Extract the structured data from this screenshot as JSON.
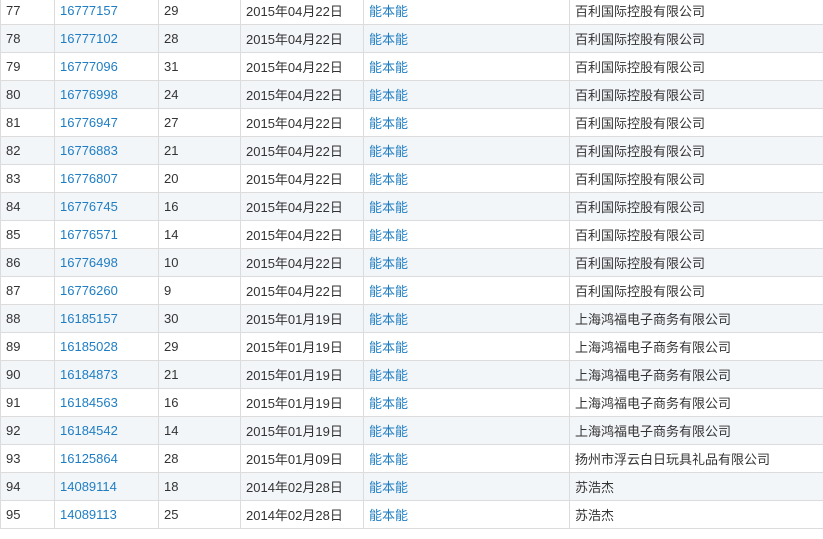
{
  "records": [
    {
      "index": "77",
      "reg_no": "16777157",
      "class": "29",
      "date": "2015年04月22日",
      "name": "能本能",
      "applicant": "百利国际控股有限公司"
    },
    {
      "index": "78",
      "reg_no": "16777102",
      "class": "28",
      "date": "2015年04月22日",
      "name": "能本能",
      "applicant": "百利国际控股有限公司"
    },
    {
      "index": "79",
      "reg_no": "16777096",
      "class": "31",
      "date": "2015年04月22日",
      "name": "能本能",
      "applicant": "百利国际控股有限公司"
    },
    {
      "index": "80",
      "reg_no": "16776998",
      "class": "24",
      "date": "2015年04月22日",
      "name": "能本能",
      "applicant": "百利国际控股有限公司"
    },
    {
      "index": "81",
      "reg_no": "16776947",
      "class": "27",
      "date": "2015年04月22日",
      "name": "能本能",
      "applicant": "百利国际控股有限公司"
    },
    {
      "index": "82",
      "reg_no": "16776883",
      "class": "21",
      "date": "2015年04月22日",
      "name": "能本能",
      "applicant": "百利国际控股有限公司"
    },
    {
      "index": "83",
      "reg_no": "16776807",
      "class": "20",
      "date": "2015年04月22日",
      "name": "能本能",
      "applicant": "百利国际控股有限公司"
    },
    {
      "index": "84",
      "reg_no": "16776745",
      "class": "16",
      "date": "2015年04月22日",
      "name": "能本能",
      "applicant": "百利国际控股有限公司"
    },
    {
      "index": "85",
      "reg_no": "16776571",
      "class": "14",
      "date": "2015年04月22日",
      "name": "能本能",
      "applicant": "百利国际控股有限公司"
    },
    {
      "index": "86",
      "reg_no": "16776498",
      "class": "10",
      "date": "2015年04月22日",
      "name": "能本能",
      "applicant": "百利国际控股有限公司"
    },
    {
      "index": "87",
      "reg_no": "16776260",
      "class": "9",
      "date": "2015年04月22日",
      "name": "能本能",
      "applicant": "百利国际控股有限公司"
    },
    {
      "index": "88",
      "reg_no": "16185157",
      "class": "30",
      "date": "2015年01月19日",
      "name": "能本能",
      "applicant": "上海鸿福电子商务有限公司"
    },
    {
      "index": "89",
      "reg_no": "16185028",
      "class": "29",
      "date": "2015年01月19日",
      "name": "能本能",
      "applicant": "上海鸿福电子商务有限公司"
    },
    {
      "index": "90",
      "reg_no": "16184873",
      "class": "21",
      "date": "2015年01月19日",
      "name": "能本能",
      "applicant": "上海鸿福电子商务有限公司"
    },
    {
      "index": "91",
      "reg_no": "16184563",
      "class": "16",
      "date": "2015年01月19日",
      "name": "能本能",
      "applicant": "上海鸿福电子商务有限公司"
    },
    {
      "index": "92",
      "reg_no": "16184542",
      "class": "14",
      "date": "2015年01月19日",
      "name": "能本能",
      "applicant": "上海鸿福电子商务有限公司"
    },
    {
      "index": "93",
      "reg_no": "16125864",
      "class": "28",
      "date": "2015年01月09日",
      "name": "能本能",
      "applicant": "扬州市浮云白日玩具礼品有限公司"
    },
    {
      "index": "94",
      "reg_no": "14089114",
      "class": "18",
      "date": "2014年02月28日",
      "name": "能本能",
      "applicant": "苏浩杰"
    },
    {
      "index": "95",
      "reg_no": "14089113",
      "class": "25",
      "date": "2014年02月28日",
      "name": "能本能",
      "applicant": "苏浩杰"
    }
  ]
}
